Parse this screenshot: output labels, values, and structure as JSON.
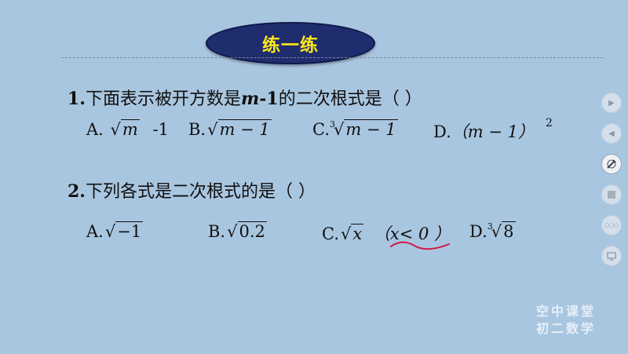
{
  "title": "练一练",
  "q1": {
    "number": "1.",
    "text_before": "下面表示被开方数是",
    "var": "m",
    "var_tail": "-1",
    "text_after": "的二次根式是（    ）",
    "options": {
      "a_label": "A.",
      "a_radicand": "m",
      "a_tail": "-1",
      "b_label": "B.",
      "b_radicand": "m − 1",
      "c_label": "C.",
      "c_index": "3",
      "c_radicand": "m − 1",
      "d_label": "D.",
      "d_expr": "（m − 1）",
      "d_power": "2"
    }
  },
  "q2": {
    "number": "2.",
    "text": "下列各式是二次根式的是（    ）",
    "options": {
      "a_label": "A.",
      "a_radicand": "−1",
      "b_label": "B.",
      "b_radicand": "0.2",
      "c_label": "C.",
      "c_radicand": "x",
      "c_condition": "（x< 0 ）",
      "d_label": "D.",
      "d_index": "3",
      "d_radicand": "8"
    }
  },
  "annotation_color": "#d01848",
  "nav": {
    "icons": [
      "chevron-right-icon",
      "chevron-left-icon",
      "pen-icon",
      "screen-icon",
      "more-icon",
      "display-icon"
    ],
    "more_label": "○○○"
  },
  "watermark": {
    "line1": "空中课堂",
    "line2": "初二数学"
  }
}
